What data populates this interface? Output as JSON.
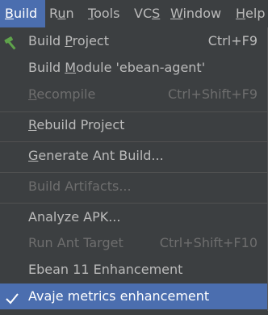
{
  "menubar": {
    "items": [
      {
        "label": "Build",
        "mnemonic": "B",
        "rest": "uild",
        "active": true
      },
      {
        "label": "Run",
        "mnemonic": "u",
        "pre": "R",
        "rest": "n"
      },
      {
        "label": "Tools",
        "mnemonic": "T",
        "rest": "ools"
      },
      {
        "label": "VCS",
        "mnemonic": "S",
        "pre": "VC",
        "rest": ""
      },
      {
        "label": "Window",
        "mnemonic": "W",
        "rest": "indow"
      },
      {
        "label": "Help",
        "mnemonic": "H",
        "rest": "elp"
      }
    ]
  },
  "menu": {
    "build_project": {
      "pre": "Build ",
      "u": "P",
      "post": "roject",
      "shortcut": "Ctrl+F9",
      "icon": "hammer-icon"
    },
    "build_module": {
      "pre": "Build ",
      "u": "M",
      "post": "odule 'ebean-agent'"
    },
    "recompile": {
      "pre": "",
      "u": "R",
      "post": "ecompile",
      "shortcut": "Ctrl+Shift+F9",
      "disabled": true
    },
    "rebuild_project": {
      "pre": "",
      "u": "R",
      "post": "ebuild Project"
    },
    "generate_ant_build": {
      "pre": "",
      "u": "G",
      "post": "enerate Ant Build..."
    },
    "build_artifacts": {
      "label": "Build Artifacts...",
      "disabled": true
    },
    "analyze_apk": {
      "label": "Analyze APK..."
    },
    "run_ant_target": {
      "label": "Run Ant Target",
      "shortcut": "Ctrl+Shift+F10",
      "disabled": true
    },
    "ebean_enhancement": {
      "label": "Ebean 11 Enhancement"
    },
    "avaje_metrics": {
      "label": "Avaje metrics enhancement",
      "checked": true,
      "icon": "checkmark-icon"
    }
  },
  "colors": {
    "background": "#3c3f41",
    "selection": "#4b6eaf",
    "text": "#bbbbbb",
    "disabled_text": "#6e6e6e",
    "hammer_green": "#5fa34b"
  }
}
